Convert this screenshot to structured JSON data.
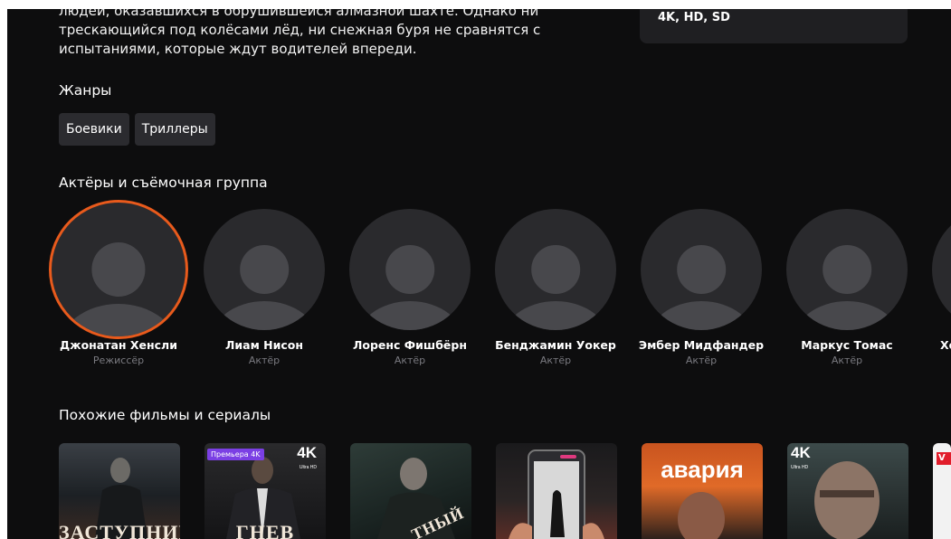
{
  "description": {
    "lines": [
      "людей, оказавшихся в обрушившейся алмазной шахте. Однако ни",
      "трескающийся под колёсами лёд, ни снежная буря не сравнятся с",
      "испытаниями, которые ждут водителей впереди."
    ]
  },
  "quality": {
    "value": "4K, HD, SD"
  },
  "genres": {
    "title": "Жанры",
    "items": [
      "Боевики",
      "Триллеры"
    ]
  },
  "cast": {
    "title": "Актёры и съёмочная группа",
    "people": [
      {
        "name": "Джонатан Хенсли",
        "role": "Режиссёр"
      },
      {
        "name": "Лиам Нисон",
        "role": "Актёр"
      },
      {
        "name": "Лоренс Фишбёрн",
        "role": "Актёр"
      },
      {
        "name": "Бенджамин Уокер",
        "role": "Актёр"
      },
      {
        "name": "Эмбер Мидфандер",
        "role": "Актёр"
      },
      {
        "name": "Маркус Томас",
        "role": "Актёр"
      },
      {
        "name": "Хо",
        "role": ""
      }
    ]
  },
  "similar": {
    "title": "Похожие фильмы и сериалы",
    "posters": [
      {
        "title": "ЗАСТУПНИК"
      },
      {
        "title": "ГНЕВ",
        "badge": "4K",
        "badge_sub": "Ultra HD",
        "premiere": "Премьера 4K"
      },
      {
        "title": "ТНЫЙ"
      },
      {
        "title": ""
      },
      {
        "title": "авария"
      },
      {
        "title": "",
        "badge": "4K",
        "badge_sub": "Ultra HD"
      },
      {
        "title": "",
        "badge": "V"
      }
    ]
  },
  "colors": {
    "accent_ring": "#e85a1c",
    "premiere_badge": "#7b3fe4"
  }
}
